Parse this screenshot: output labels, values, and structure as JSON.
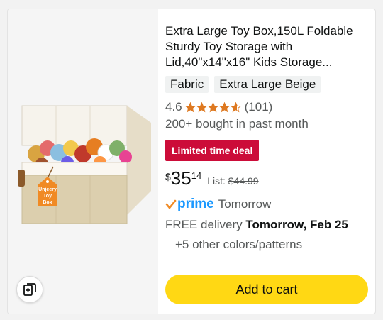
{
  "product": {
    "title": "Extra Large Toy Box,150L Foldable Sturdy Toy Storage with Lid,40\"x14\"x16\" Kids Storage...",
    "chips": [
      "Fabric",
      "Extra Large Beige"
    ],
    "rating": "4.6",
    "rating_value": 4.6,
    "review_count": "(101)",
    "bought": "200+ bought in past month",
    "deal_badge": "Limited time deal",
    "price": {
      "symbol": "$",
      "whole": "35",
      "fraction": "14",
      "list_label": "List:",
      "list_price": "$44.99"
    },
    "prime": {
      "label": "prime",
      "when": "Tomorrow"
    },
    "delivery": {
      "prefix": "FREE delivery",
      "date": "Tomorrow, Feb 25"
    },
    "colors": "+5 other colors/patterns",
    "tag_text": "Unjeery Toy Box",
    "add_to_cart": "Add to cart"
  },
  "colors_theme": {
    "deal_red": "#cc0c39",
    "cart_yellow": "#ffd814",
    "star_orange": "#de7921",
    "prime_blue": "#1a98ff"
  },
  "icons": {
    "similar": "similar-items-icon",
    "star": "star-icon",
    "prime_check": "prime-check-icon"
  }
}
